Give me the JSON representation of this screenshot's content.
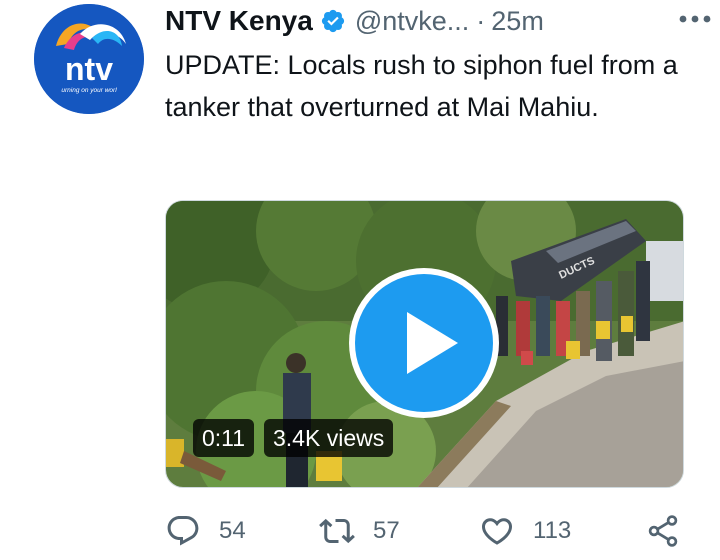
{
  "tweet": {
    "display_name": "NTV Kenya",
    "handle": "@ntvke...",
    "separator": "·",
    "time": "25m",
    "verified": true,
    "text": "UPDATE: Locals rush to siphon fuel from a tanker that overturned at Mai Mahiu.",
    "avatar": {
      "brand": "ntv",
      "tagline": "urning on your worl",
      "background": "#1557c0"
    },
    "video": {
      "duration": "0:11",
      "views": "3.4K views",
      "tanker_lettering": "DUCTS"
    },
    "actions": {
      "reply_count": "54",
      "retweet_count": "57",
      "like_count": "113"
    },
    "icons": {
      "verified": "verified-badge-icon",
      "more": "more-options-icon",
      "reply": "reply-icon",
      "retweet": "retweet-icon",
      "like": "heart-icon",
      "share": "share-icon",
      "play": "play-icon"
    },
    "colors": {
      "accent": "#1d9bf0",
      "secondary_text": "#536471",
      "primary_text": "#0f1419"
    }
  }
}
